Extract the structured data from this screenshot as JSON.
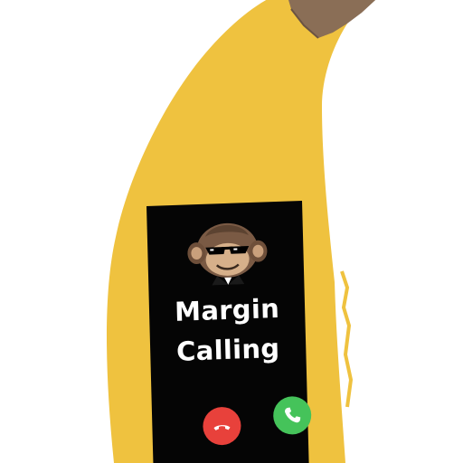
{
  "caller": {
    "name": "Margin Calling"
  },
  "icons": {
    "avatar": "monkey-with-sunglasses-icon",
    "decline": "phone-hangup-icon",
    "accept": "phone-answer-icon"
  },
  "colors": {
    "banana": "#efc23f",
    "stem": "#8a6e56",
    "screen": "#050505",
    "decline": "#e8413b",
    "accept": "#45c35a"
  }
}
